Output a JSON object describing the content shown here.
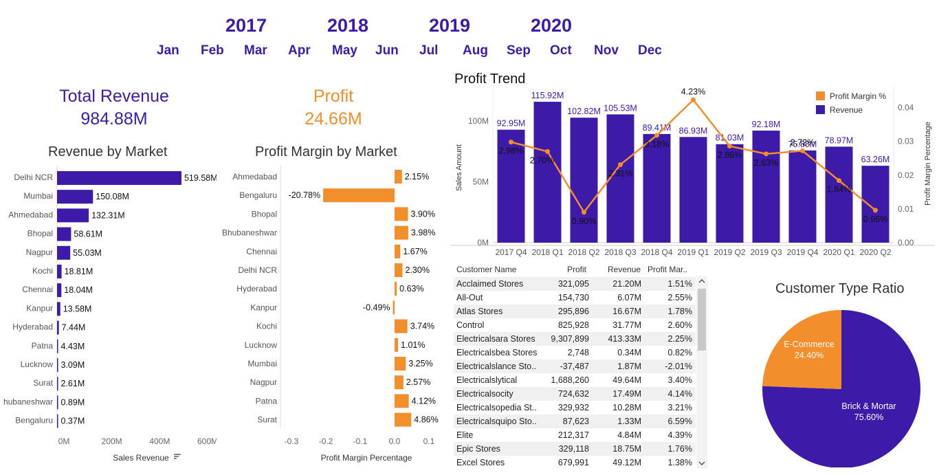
{
  "filters": {
    "years": [
      "2017",
      "2018",
      "2019",
      "2020"
    ],
    "months": [
      "Jan",
      "Feb",
      "Mar",
      "Apr",
      "May",
      "Jun",
      "Jul",
      "Aug",
      "Sep",
      "Oct",
      "Nov",
      "Dec"
    ]
  },
  "kpis": {
    "revenue_label": "Total Revenue",
    "revenue_value": "984.88M",
    "profit_label": "Profit",
    "profit_value": "24.66M"
  },
  "colors": {
    "purple": "#3d1aa8",
    "orange": "#f28e2b"
  },
  "profit_trend_title": "Profit Trend",
  "revenue_by_market_title": "Revenue by Market",
  "margin_by_market_title": "Profit Margin by Market",
  "customer_type_title": "Customer Type Ratio",
  "chart_data": [
    {
      "type": "bar",
      "title": "Revenue by Market",
      "xlabel": "Sales Revenue",
      "categories": [
        "Delhi NCR",
        "Mumbai",
        "Ahmedabad",
        "Bhopal",
        "Nagpur",
        "Kochi",
        "Chennai",
        "Kanpur",
        "Hyderabad",
        "Patna",
        "Lucknow",
        "Surat",
        "Bhubaneshwar",
        "Bengaluru"
      ],
      "category_labels": [
        "Delhi NCR",
        "Mumbai",
        "Ahmedabad",
        "Bhopal",
        "Nagpur",
        "Kochi",
        "Chennai",
        "Kanpur",
        "Hyderabad",
        "Patna",
        "Lucknow",
        "Surat",
        "hubaneshwar",
        "Bengaluru"
      ],
      "values": [
        519.58,
        150.08,
        132.31,
        58.61,
        55.03,
        18.81,
        18.04,
        13.58,
        7.44,
        4.43,
        3.09,
        2.61,
        0.89,
        0.37
      ],
      "labels": [
        "519.58M",
        "150.08M",
        "132.31M",
        "58.61M",
        "55.03M",
        "18.81M",
        "18.04M",
        "13.58M",
        "7.44M",
        "4.43M",
        "3.09M",
        "2.61M",
        "0.89M",
        "0.37M"
      ],
      "ticks": [
        "0M",
        "200M",
        "400M",
        "600M"
      ],
      "xlim": [
        0,
        600
      ]
    },
    {
      "type": "bar",
      "title": "Profit Margin by Market",
      "xlabel": "Profit Margin Percentage",
      "categories": [
        "Ahmedabad",
        "Bengaluru",
        "Bhopal",
        "Bhubaneshwar",
        "Chennai",
        "Delhi NCR",
        "Hyderabad",
        "Kanpur",
        "Kochi",
        "Lucknow",
        "Mumbai",
        "Nagpur",
        "Patna",
        "Surat"
      ],
      "values": [
        0.0215,
        -0.2078,
        0.039,
        0.0398,
        0.0167,
        0.023,
        0.0063,
        -0.0049,
        0.0374,
        0.0101,
        0.0325,
        0.0257,
        0.0412,
        0.0486
      ],
      "labels": [
        "2.15%",
        "-20.78%",
        "3.90%",
        "3.98%",
        "1.67%",
        "2.30%",
        "0.63%",
        "-0.49%",
        "3.74%",
        "1.01%",
        "3.25%",
        "2.57%",
        "4.12%",
        "4.86%"
      ],
      "ticks": [
        "-0.3",
        "-0.2",
        "-0.1",
        "0.0",
        "0.1"
      ],
      "xlim": [
        -0.3,
        0.1
      ]
    },
    {
      "type": "bar+line",
      "title": "Profit Trend",
      "ylabel": "Sales Amount",
      "y2label": "Profit Margin Percentage",
      "categories": [
        "2017 Q4",
        "2018 Q1",
        "2018 Q2",
        "2018 Q3",
        "2018 Q4",
        "2019 Q1",
        "2019 Q2",
        "2019 Q3",
        "2019 Q4",
        "2020 Q1",
        "2020 Q2"
      ],
      "series": [
        {
          "name": "Revenue",
          "values": [
            92.95,
            115.92,
            102.82,
            105.53,
            89.41,
            86.93,
            81.03,
            92.18,
            75.88,
            78.97,
            63.26
          ],
          "labels": [
            "92.95M",
            "115.92M",
            "102.82M",
            "105.53M",
            "89.41M",
            "86.93M",
            "81.03M",
            "92.18M",
            "75.88M",
            "78.97M",
            "63.26M"
          ]
        },
        {
          "name": "Profit Margin %",
          "values": [
            2.98,
            2.7,
            0.9,
            2.31,
            3.18,
            4.23,
            2.86,
            2.63,
            2.72,
            1.84,
            0.96
          ],
          "labels": [
            "2.98%",
            "2.70%",
            "0.90%",
            "2.31%",
            "3.18%",
            "4.23%",
            "2.86%",
            "2.63%",
            "2.72%",
            "1.84%",
            "0.96%"
          ]
        }
      ],
      "yticks": [
        "0M",
        "50M",
        "100M"
      ],
      "y2ticks": [
        "0.00",
        "0.01",
        "0.02",
        "0.03",
        "0.04"
      ],
      "ylim": [
        0,
        125
      ],
      "y2lim": [
        0,
        0.045
      ],
      "legend": "top-right"
    },
    {
      "type": "pie",
      "title": "Customer Type Ratio",
      "slices": [
        {
          "name": "Brick & Mortar",
          "value": 75.6,
          "label": "75.60%"
        },
        {
          "name": "E-Commerce",
          "value": 24.4,
          "label": "24.40%"
        }
      ]
    },
    {
      "type": "table",
      "columns": [
        "Customer Name",
        "Profit",
        "Revenue",
        "Profit Mar.."
      ],
      "rows": [
        [
          "Acclaimed Stores",
          "321,095",
          "21.20M",
          "1.51%"
        ],
        [
          "All-Out",
          "154,730",
          "6.07M",
          "2.55%"
        ],
        [
          "Atlas Stores",
          "295,896",
          "16.67M",
          "1.78%"
        ],
        [
          "Control",
          "825,928",
          "31.77M",
          "2.60%"
        ],
        [
          "Electricalsara Stores",
          "9,307,899",
          "413.33M",
          "2.25%"
        ],
        [
          "Electricalsbea Stores",
          "2,748",
          "0.34M",
          "0.82%"
        ],
        [
          "Electricalslance Sto..",
          "-37,487",
          "1.87M",
          "-2.01%"
        ],
        [
          "Electricalslytical",
          "1,688,260",
          "49.64M",
          "3.40%"
        ],
        [
          "Electricalsocity",
          "724,632",
          "17.49M",
          "4.14%"
        ],
        [
          "Electricalsopedia St..",
          "329,932",
          "10.28M",
          "3.21%"
        ],
        [
          "Electricalsquipo Sto..",
          "87,623",
          "1.33M",
          "6.59%"
        ],
        [
          "Elite",
          "212,317",
          "4.84M",
          "4.39%"
        ],
        [
          "Epic Stores",
          "329,118",
          "18.75M",
          "1.76%"
        ],
        [
          "Excel Stores",
          "679,991",
          "49.12M",
          "1.38%"
        ]
      ]
    }
  ]
}
